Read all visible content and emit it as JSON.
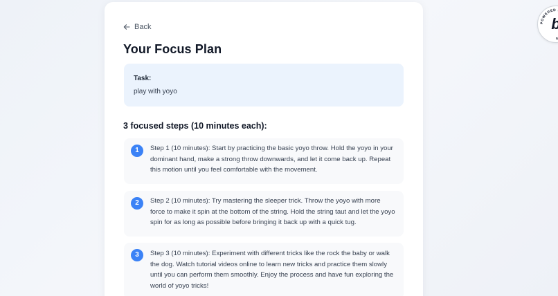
{
  "nav": {
    "back_label": "Back",
    "back_icon": "arrow-left-icon"
  },
  "page": {
    "title": "Your Focus Plan"
  },
  "task": {
    "label": "Task:",
    "text": "play with yoyo"
  },
  "steps_heading": "3 focused steps (10 minutes each):",
  "steps": [
    {
      "number": "1",
      "text": "Step 1 (10 minutes): Start by practicing the basic yoyo throw. Hold the yoyo in your dominant hand, make a strong throw downwards, and let it come back up. Repeat this motion until you feel comfortable with the movement."
    },
    {
      "number": "2",
      "text": "Step 2 (10 minutes): Try mastering the sleeper trick. Throw the yoyo with more force to make it spin at the bottom of the string. Hold the string taut and let the yoyo spin for as long as possible before bringing it back up with a quick tug."
    },
    {
      "number": "3",
      "text": "Step 3 (10 minutes): Experiment with different tricks like the rock the baby or walk the dog. Watch tutorial videos online to learn new tricks and practice them slowly until you can perform them smoothly. Enjoy the process and have fun exploring the world of yoyo tricks!"
    }
  ],
  "badge": {
    "letter": "b",
    "ring_text": "POWERED BY BOLT · MADE IN"
  },
  "colors": {
    "accent": "#3b82f6",
    "task_bg": "#ebf3fd",
    "step_bg": "#f8f9fb",
    "title": "#111827"
  }
}
